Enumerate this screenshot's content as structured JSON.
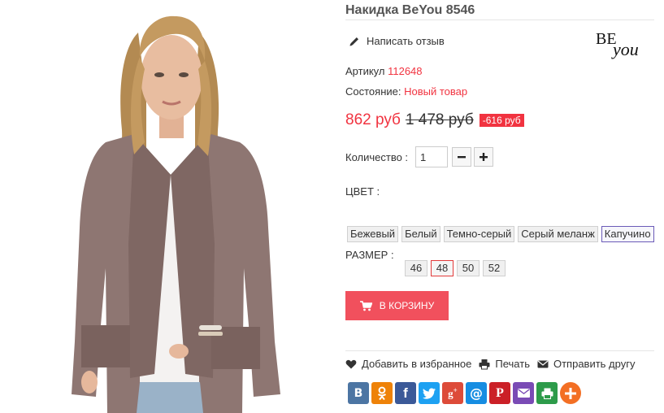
{
  "product": {
    "title": "Накидка BeYou 8546",
    "image_alt": "Woman in a long taupe cardigan"
  },
  "brand_logo": {
    "icon": "beyou-brand-logo",
    "text": "BEyou"
  },
  "review": {
    "label": "Написать отзыв",
    "icon": "pencil-icon"
  },
  "sku": {
    "label": "Артикул",
    "value": "112648"
  },
  "condition": {
    "label": "Состояние:",
    "value": "Новый товар"
  },
  "price": {
    "current": "862 руб",
    "old": "1 478 руб",
    "discount": "-616 руб"
  },
  "quantity": {
    "label": "Количество :",
    "value": "1",
    "minus_icon": "minus-icon",
    "plus_icon": "plus-icon"
  },
  "color": {
    "label": "ЦВЕТ :",
    "options": [
      "Бежевый",
      "Белый",
      "Темно-серый",
      "Серый меланж",
      "Капучино"
    ],
    "selected": "Капучино"
  },
  "size": {
    "label": "РАЗМЕР :",
    "options": [
      "46",
      "48",
      "50",
      "52"
    ],
    "selected": "48"
  },
  "cart": {
    "label": "В КОРЗИНУ",
    "icon": "cart-icon"
  },
  "actions": {
    "wishlist": "Добавить в избранное",
    "print": "Печать",
    "send": "Отправить другу"
  },
  "share": [
    {
      "name": "vkontakte",
      "glyph": "B",
      "color": "#4c75a3"
    },
    {
      "name": "odnoklassniki",
      "glyph": "ok",
      "color": "#ee8208"
    },
    {
      "name": "facebook",
      "glyph": "f",
      "color": "#3b5998"
    },
    {
      "name": "twitter",
      "glyph": "tw",
      "color": "#1da1f2"
    },
    {
      "name": "googleplus",
      "glyph": "g+",
      "color": "#dd4b39"
    },
    {
      "name": "mailru",
      "glyph": "@",
      "color": "#168de2"
    },
    {
      "name": "pinterest",
      "glyph": "P",
      "color": "#cb2027"
    },
    {
      "name": "email",
      "glyph": "mail",
      "color": "#7a4bb5"
    },
    {
      "name": "print",
      "glyph": "print",
      "color": "#2d9b4a"
    },
    {
      "name": "more",
      "glyph": "+",
      "color": "#f36f24"
    }
  ],
  "colors": {
    "accent": "#f13340",
    "cart_button": "#f1505d",
    "selected_color_border": "#6b5bb8",
    "selected_size_border": "#e23b3b"
  }
}
